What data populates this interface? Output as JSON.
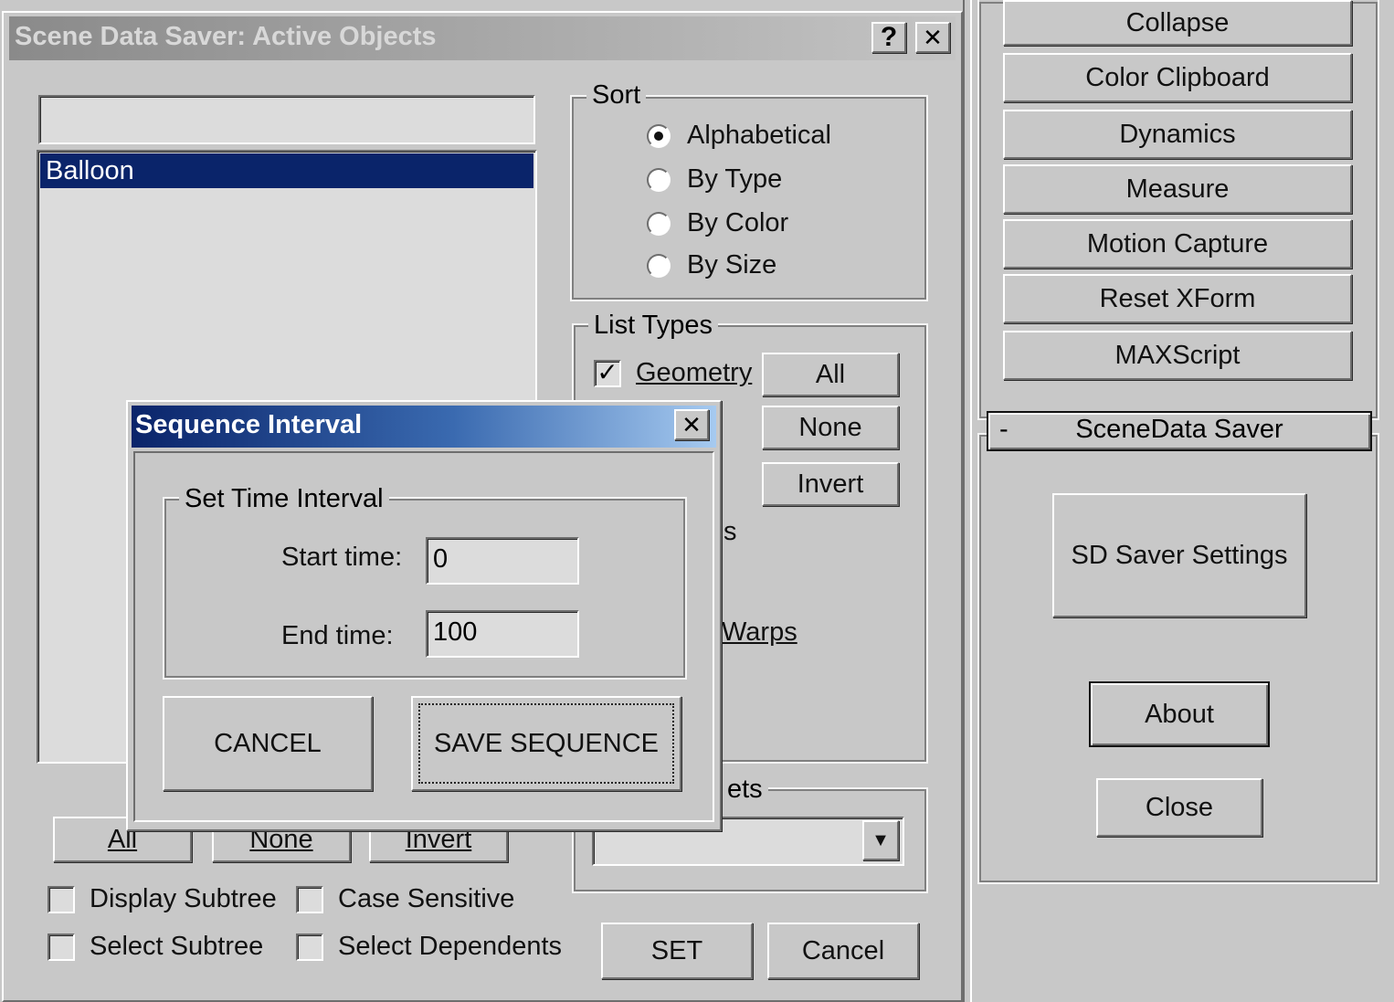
{
  "main_dialog": {
    "title": "Scene Data Saver: Active Objects",
    "help_button": "?",
    "close_button": "✕",
    "filter_value": "",
    "object_list": [
      "Balloon"
    ],
    "bottom_buttons": {
      "all": "All",
      "none": "None",
      "invert": "Invert"
    },
    "checkboxes": {
      "display_subtree": {
        "label": "Display Subtree",
        "checked": false
      },
      "case_sensitive": {
        "label": "Case Sensitive",
        "checked": false
      },
      "select_subtree": {
        "label": "Select Subtree",
        "checked": false
      },
      "select_dependents": {
        "label": "Select Dependents",
        "checked": false
      }
    },
    "sort": {
      "title": "Sort",
      "options": [
        "Alphabetical",
        "By Type",
        "By Color",
        "By Size"
      ],
      "selected": "Alphabetical"
    },
    "list_types": {
      "title": "List Types",
      "geometry": {
        "label": "Geometry",
        "checked": true
      },
      "buttons": {
        "all": "All",
        "none": "None",
        "invert": "Invert"
      },
      "partial_item": "s",
      "warps": "Warps"
    },
    "selection_sets": {
      "partial_title": "ets",
      "value": "",
      "dropdown_arrow": "▼"
    },
    "set_button": "SET",
    "cancel_button": "Cancel"
  },
  "sequence_dialog": {
    "title": "Sequence Interval",
    "close_button": "✕",
    "group_title": "Set Time Interval",
    "start_label": "Start time:",
    "start_value": "0",
    "end_label": "End time:",
    "end_value": "100",
    "cancel_button": "CANCEL",
    "save_button": "SAVE SEQUENCE"
  },
  "utility_panel": {
    "buttons": [
      "Collapse",
      "Color Clipboard",
      "Dynamics",
      "Measure",
      "Motion Capture",
      "Reset XForm",
      "MAXScript"
    ],
    "rollout_toggle": "-",
    "rollout_title": "SceneData Saver",
    "settings_button": "SD Saver Settings",
    "about_button": "About",
    "close_button": "Close"
  },
  "colors": {
    "dialog_bg": "#c8c8c8",
    "selection_highlight": "#0a246a",
    "active_title_start": "#0a246a",
    "active_title_end": "#a6caf0",
    "inactive_title_start": "#808080",
    "inactive_title_end": "#c0c0c0"
  }
}
